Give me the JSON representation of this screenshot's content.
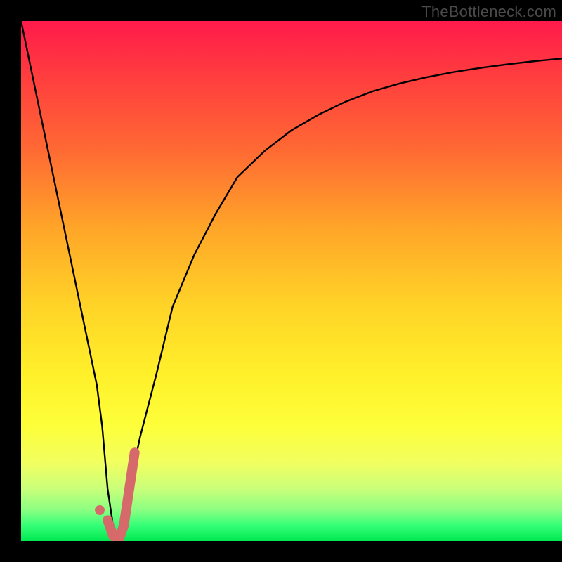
{
  "watermark": "TheBottleneck.com",
  "colors": {
    "curve": "#000000",
    "highlight": "#d66a6a",
    "marker": "#d66a6a",
    "frame": "#000000"
  },
  "chart_data": {
    "type": "line",
    "title": "",
    "xlabel": "",
    "ylabel": "",
    "xlim": [
      0,
      100
    ],
    "ylim": [
      0,
      100
    ],
    "grid": false,
    "series": [
      {
        "name": "bottleneck-curve",
        "x": [
          0,
          2,
          4,
          6,
          8,
          10,
          12,
          14,
          15,
          16,
          17,
          18,
          19,
          20,
          22,
          25,
          28,
          32,
          36,
          40,
          45,
          50,
          55,
          60,
          65,
          70,
          75,
          80,
          85,
          90,
          95,
          100
        ],
        "values": [
          100,
          90,
          80,
          70,
          60,
          50,
          40,
          30,
          22,
          10,
          3,
          0,
          3,
          10,
          20,
          32,
          45,
          55,
          63,
          70,
          75,
          79,
          82,
          84.5,
          86.5,
          88,
          89.2,
          90.2,
          91,
          91.7,
          92.3,
          92.8
        ]
      }
    ],
    "highlight_segment": {
      "description": "pink J-shaped segment near minimum",
      "x": [
        16,
        17,
        18,
        19,
        20,
        21
      ],
      "values": [
        4,
        1,
        0,
        3,
        10,
        17
      ]
    },
    "marker": {
      "x": 14.5,
      "y": 6
    },
    "background_gradient": {
      "stops": [
        {
          "pos": 0.0,
          "color": "#ff1a4b"
        },
        {
          "pos": 0.25,
          "color": "#ff6a33"
        },
        {
          "pos": 0.55,
          "color": "#ffd427"
        },
        {
          "pos": 0.78,
          "color": "#fdff3a"
        },
        {
          "pos": 0.94,
          "color": "#8cff82"
        },
        {
          "pos": 1.0,
          "color": "#00e851"
        }
      ]
    }
  }
}
